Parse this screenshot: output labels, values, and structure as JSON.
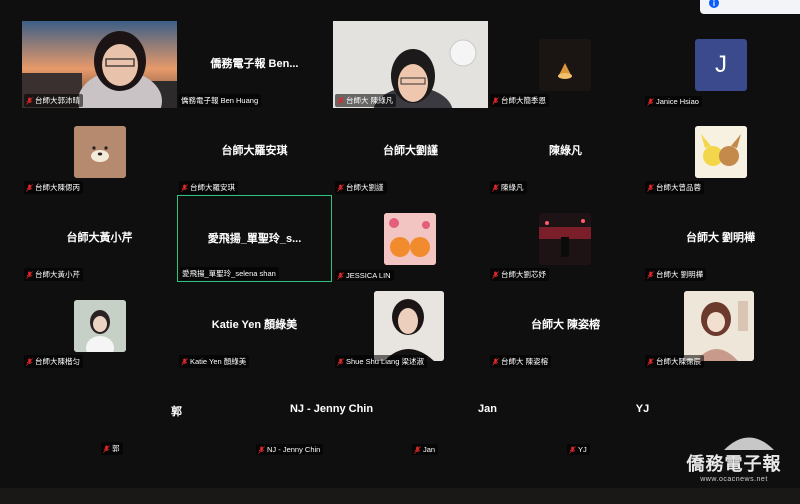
{
  "notice": {
    "info_glyph": "i"
  },
  "participants": [
    {
      "id": "p1",
      "label": "台師大郭沛晴",
      "display": "",
      "kind": "video"
    },
    {
      "id": "p2",
      "label": "僑務電子報 Ben Huang",
      "display": "僑務電子報 Ben...",
      "kind": "name"
    },
    {
      "id": "p3",
      "label": "台師大 陳綠凡",
      "display": "",
      "kind": "video"
    },
    {
      "id": "p4",
      "label": "台師大簡季恩",
      "display": "",
      "kind": "avatar"
    },
    {
      "id": "p5",
      "label": "Janice Hsiao",
      "display": "",
      "kind": "letter",
      "letter": "J"
    },
    {
      "id": "p6",
      "label": "台師大陳偲丙",
      "display": "",
      "kind": "avatar"
    },
    {
      "id": "p7",
      "label": "台師大羅安琪",
      "display": "台師大羅安琪",
      "kind": "name"
    },
    {
      "id": "p8",
      "label": "台師大劉謹",
      "display": "台師大劉謹",
      "kind": "name"
    },
    {
      "id": "p9",
      "label": "陳綠凡",
      "display": "陳綠凡",
      "kind": "name"
    },
    {
      "id": "p10",
      "label": "台師大曾品蓉",
      "display": "",
      "kind": "avatar"
    },
    {
      "id": "p11",
      "label": "台師大黃小芹",
      "display": "台師大黃小芹",
      "kind": "name"
    },
    {
      "id": "p12",
      "label": "愛飛揚_單聖玲_selena shan",
      "display": "愛飛揚_單聖玲_s...",
      "kind": "name"
    },
    {
      "id": "p13",
      "label": "JESSICA LIN",
      "display": "",
      "kind": "avatar"
    },
    {
      "id": "p14",
      "label": "台師大劉芯妤",
      "display": "",
      "kind": "avatar"
    },
    {
      "id": "p15",
      "label": "台師大 劉明樺",
      "display": "台師大 劉明樺",
      "kind": "name"
    },
    {
      "id": "p16",
      "label": "台師大陳楷匀",
      "display": "",
      "kind": "avatar"
    },
    {
      "id": "p17",
      "label": "Katie Yen 顏綠美",
      "display": "Katie Yen 顏綠美",
      "kind": "name"
    },
    {
      "id": "p18",
      "label": "Shue Shu Liang 梁述淑",
      "display": "",
      "kind": "avatar"
    },
    {
      "id": "p19",
      "label": "台師大 陳姿榕",
      "display": "台師大 陳姿榕",
      "kind": "name"
    },
    {
      "id": "p20",
      "label": "台師大陳霈辰",
      "display": "",
      "kind": "avatar"
    },
    {
      "id": "p21",
      "label": "郭",
      "display": "郭",
      "kind": "name"
    },
    {
      "id": "p22",
      "label": "NJ - Jenny Chin",
      "display": "NJ - Jenny Chin",
      "kind": "name"
    },
    {
      "id": "p23",
      "label": "Jan",
      "display": "Jan",
      "kind": "name"
    },
    {
      "id": "p24",
      "label": "YJ",
      "display": "YJ",
      "kind": "name"
    }
  ],
  "watermark": {
    "text": "僑務電子報",
    "url": "www.ocacnews.net"
  },
  "colors": {
    "background": "#0f0f0f",
    "active_speaker": "#2ec27e",
    "mic_muted": "#e02828"
  }
}
